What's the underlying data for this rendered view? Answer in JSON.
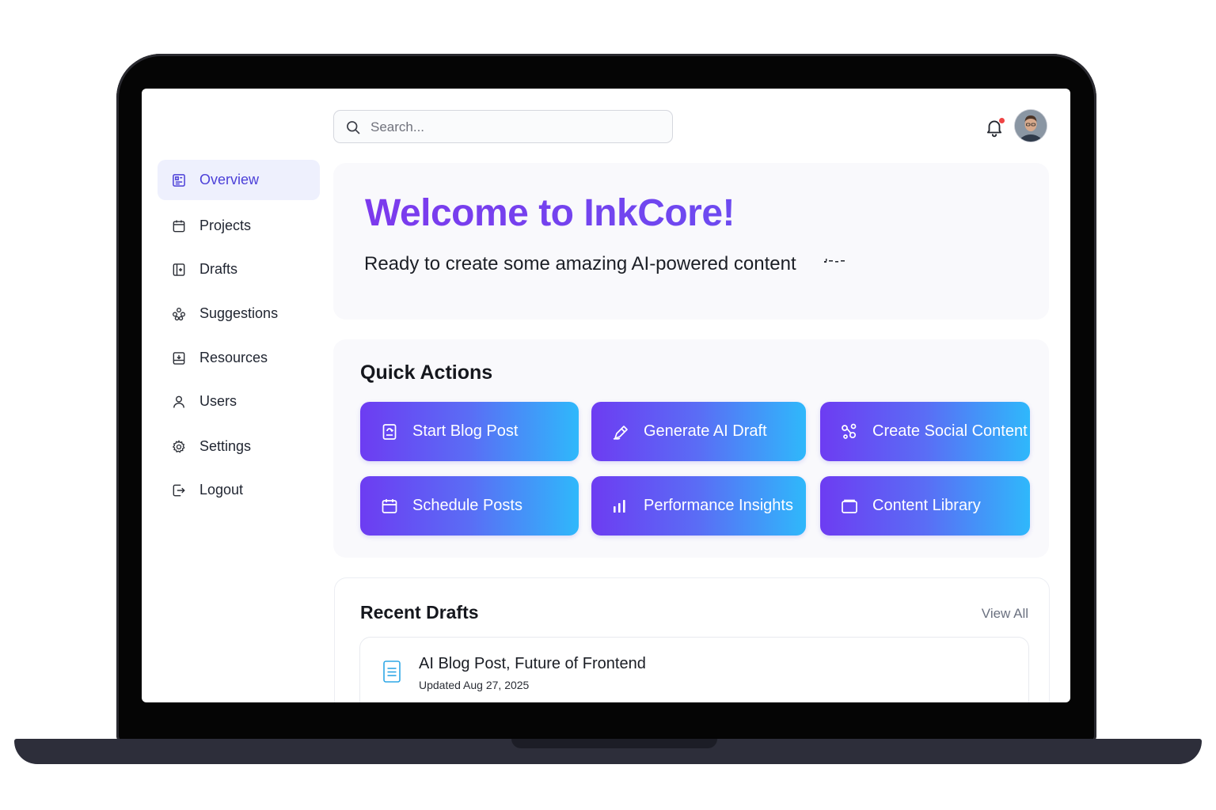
{
  "search": {
    "placeholder": "Search..."
  },
  "header": {
    "notification_icon": "bell-icon",
    "avatar_icon": "user-avatar"
  },
  "sidebar": {
    "items": [
      {
        "label": "Overview",
        "icon": "overview-icon",
        "active": true
      },
      {
        "label": "Projects",
        "icon": "calendar-icon"
      },
      {
        "label": "Drafts",
        "icon": "drafts-icon"
      },
      {
        "label": "Suggestions",
        "icon": "suggestions-icon"
      },
      {
        "label": "Resources",
        "icon": "resources-icon"
      },
      {
        "label": "Users",
        "icon": "user-icon"
      },
      {
        "label": "Settings",
        "icon": "gear-icon"
      },
      {
        "label": "Logout",
        "icon": "logout-icon"
      }
    ]
  },
  "welcome": {
    "title": "Welcome to InkCore!",
    "subtitle": "Ready to create some amazing AI-powered content"
  },
  "quick_actions": {
    "title": "Quick Actions",
    "items": [
      {
        "label": "Start Blog Post",
        "icon": "document-icon"
      },
      {
        "label": "Generate AI Draft",
        "icon": "pen-icon"
      },
      {
        "label": "Create Social Content",
        "icon": "social-nodes-icon"
      },
      {
        "label": "Schedule Posts",
        "icon": "calendar-icon"
      },
      {
        "label": "Performance Insights",
        "icon": "bar-chart-icon"
      },
      {
        "label": "Content Library",
        "icon": "folder-icon"
      }
    ]
  },
  "recent_drafts": {
    "title": "Recent Drafts",
    "view_all": "View All",
    "items": [
      {
        "title": "AI Blog Post, Future of Frontend",
        "updated": "Updated Aug 27, 2025",
        "icon": "document-icon"
      }
    ]
  },
  "colors": {
    "accent": "#4b3fd8",
    "title_gradient_start": "#7c3aed",
    "button_gradient_start": "#6d3cf2",
    "button_gradient_end": "#2fb8fb",
    "notification_dot": "#ef4444"
  }
}
